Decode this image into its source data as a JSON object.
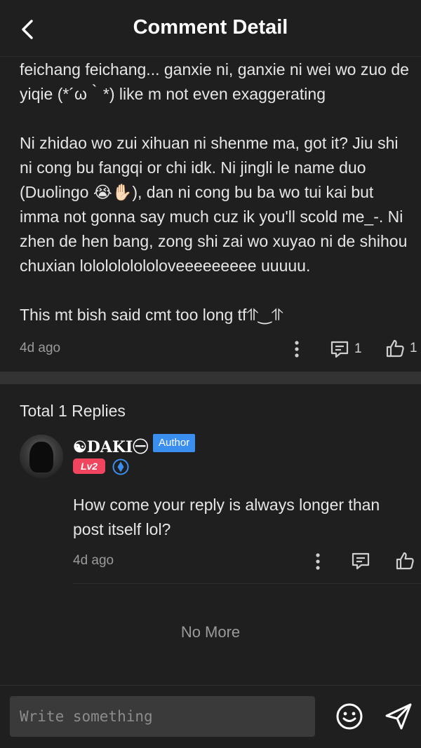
{
  "header": {
    "title": "Comment Detail"
  },
  "comment": {
    "body": "feichang feichang... ganxie ni, ganxie ni wei wo zuo de yiqie (*´ω｀*) like m not even exaggerating\n\nNi zhidao wo zui xihuan ni shenme ma, got it? Jiu shi ni cong bu fangqi or chi idk. Ni jingli le name duo (Duolingo 😭✋🏻), dan ni cong bu ba wo tui kai but imma not gonna say much cuz ik you'll scold me_-. Ni zhen de hen bang, zong shi zai wo xuyao ni de shihou chuxian lololololololoveeeeeeeee uuuuu.\n\nThis mt bish said cmt too long tf⥣‿⥣",
    "time": "4d ago",
    "reply_count": "1",
    "like_count": "1"
  },
  "replies": {
    "title": "Total 1 Replies",
    "items": [
      {
        "username": "☯DAKI㊀",
        "author_badge": "Author",
        "level": "Lv2",
        "text": "How come your reply is always longer than post itself lol?",
        "time": "4d ago"
      }
    ],
    "no_more": "No More"
  },
  "composer": {
    "placeholder": "Write something"
  },
  "colors": {
    "background": "#1f1f1f",
    "author_badge": "#3a8ef0",
    "level_badge": "#f0445f",
    "divider": "#333333"
  },
  "icons": [
    "back-arrow-icon",
    "more-vertical-icon",
    "comment-icon",
    "thumb-up-icon",
    "verified-icon",
    "emoji-icon",
    "send-icon"
  ]
}
